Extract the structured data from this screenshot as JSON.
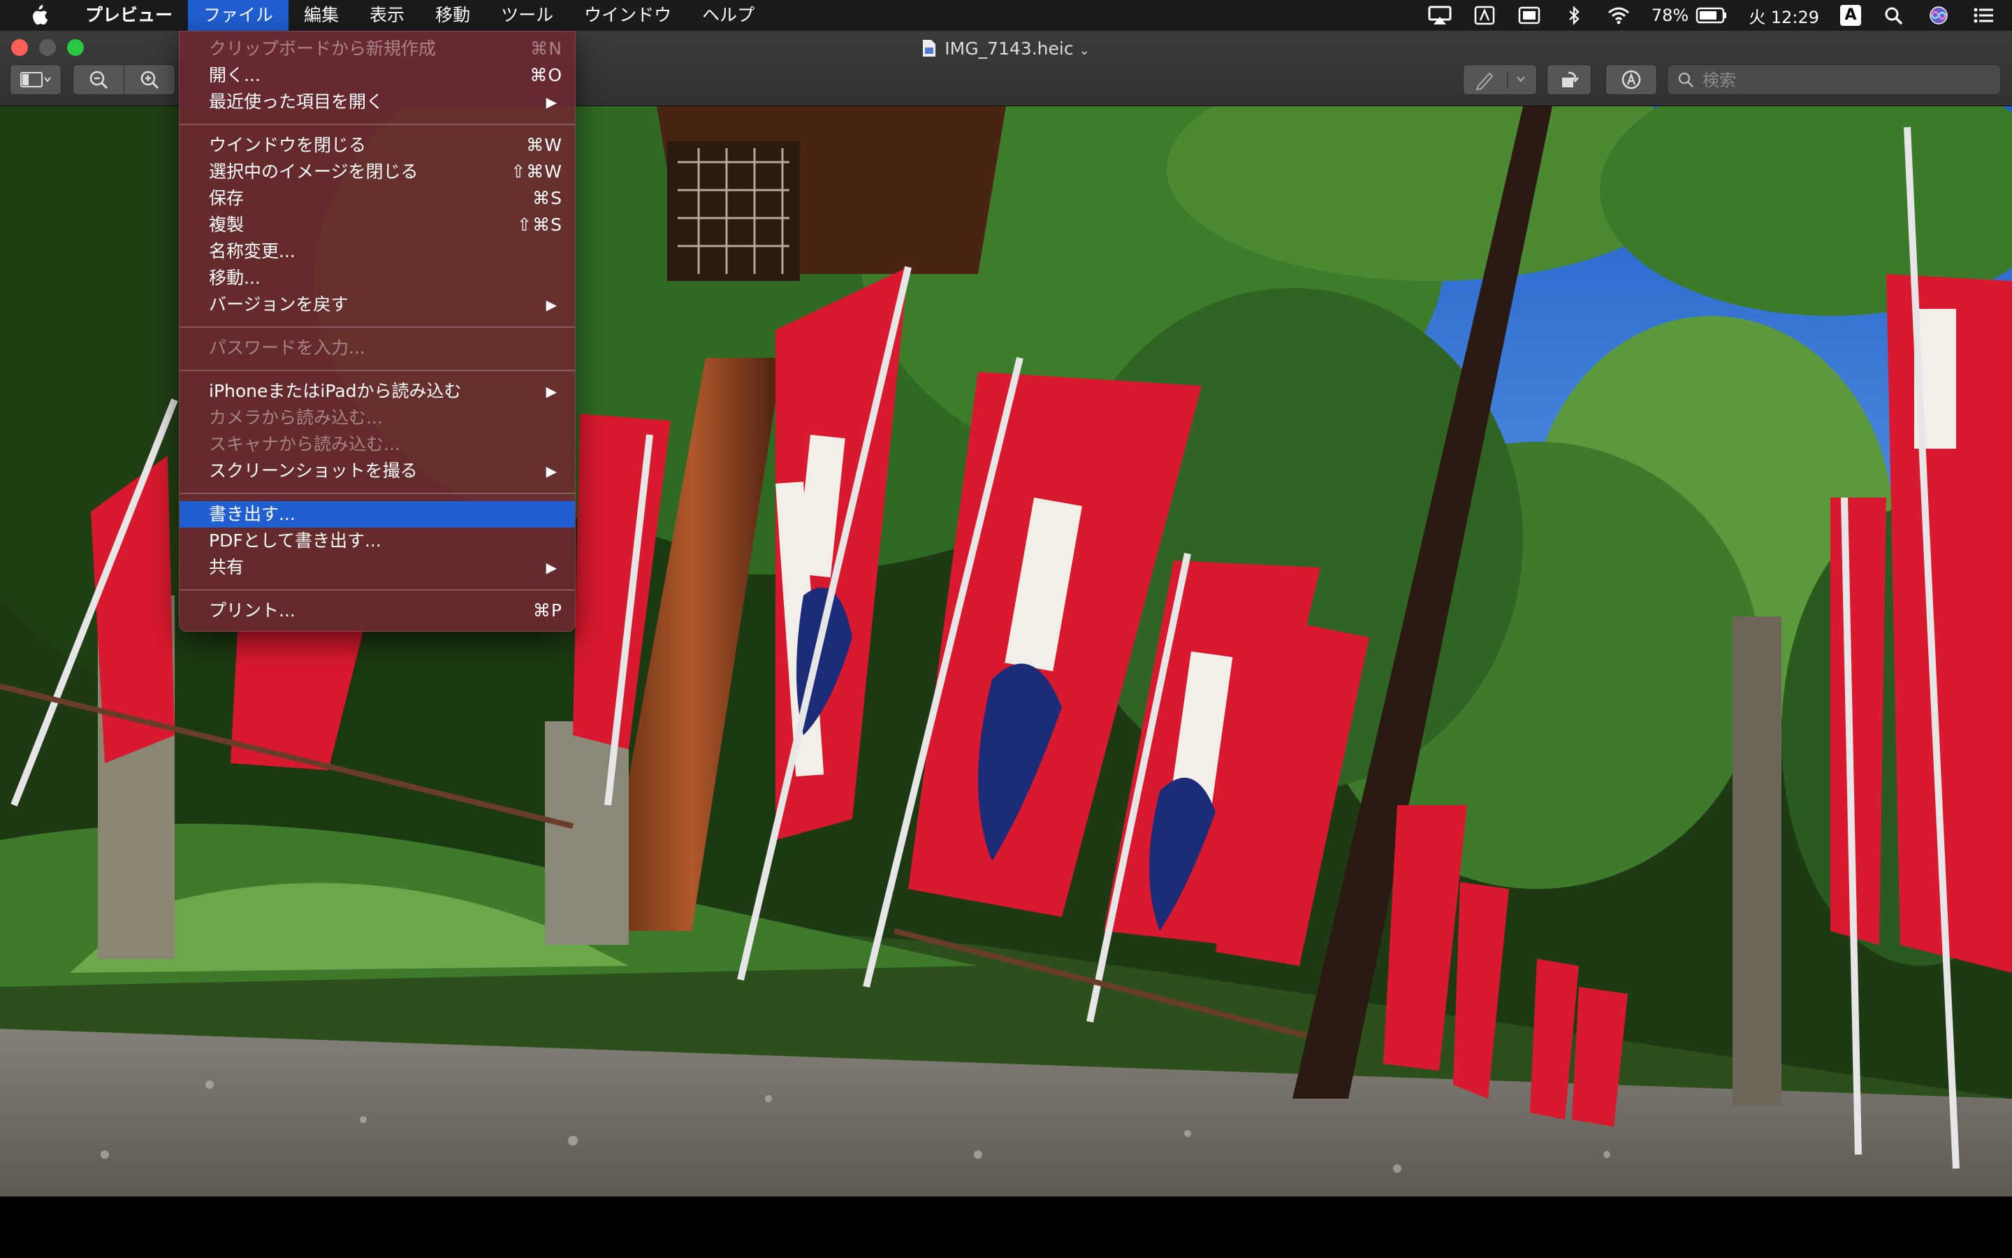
{
  "menubar": {
    "app_name": "プレビュー",
    "menus": [
      "ファイル",
      "編集",
      "表示",
      "移動",
      "ツール",
      "ウインドウ",
      "ヘルプ"
    ],
    "active_menu": "ファイル",
    "battery_percent": "78%",
    "clock": "火 12:29",
    "input_source": "A",
    "icons": [
      "apple-icon",
      "airplay-icon",
      "text-input-icon",
      "display-icon",
      "bluetooth-icon",
      "wifi-icon",
      "battery-icon",
      "spotlight-icon",
      "siri-icon",
      "notification-center-icon"
    ]
  },
  "window": {
    "title": "IMG_7143.heic",
    "search_placeholder": "検索"
  },
  "file_menu": {
    "items": [
      {
        "label": "クリップボードから新規作成",
        "shortcut": "⌘N",
        "disabled": true
      },
      {
        "label": "開く...",
        "shortcut": "⌘O",
        "disabled": false
      },
      {
        "label": "最近使った項目を開く",
        "shortcut": "▶",
        "disabled": false,
        "submenu": true
      },
      {
        "label": "ウインドウを閉じる",
        "shortcut": "⌘W",
        "disabled": false
      },
      {
        "label": "選択中のイメージを閉じる",
        "shortcut": "⇧⌘W",
        "disabled": false
      },
      {
        "label": "保存",
        "shortcut": "⌘S",
        "disabled": false
      },
      {
        "label": "複製",
        "shortcut": "⇧⌘S",
        "disabled": false
      },
      {
        "label": "名称変更...",
        "shortcut": "",
        "disabled": false
      },
      {
        "label": "移動...",
        "shortcut": "",
        "disabled": false
      },
      {
        "label": "バージョンを戻す",
        "shortcut": "▶",
        "disabled": false,
        "submenu": true
      },
      {
        "label": "パスワードを入力...",
        "shortcut": "",
        "disabled": true
      },
      {
        "label": "iPhoneまたはiPadから読み込む",
        "shortcut": "▶",
        "disabled": false,
        "submenu": true
      },
      {
        "label": "カメラから読み込む...",
        "shortcut": "",
        "disabled": true
      },
      {
        "label": "スキャナから読み込む...",
        "shortcut": "",
        "disabled": true
      },
      {
        "label": "スクリーンショットを撮る",
        "shortcut": "▶",
        "disabled": false,
        "submenu": true
      },
      {
        "label": "書き出す...",
        "shortcut": "",
        "disabled": false,
        "highlighted": true
      },
      {
        "label": "PDFとして書き出す...",
        "shortcut": "",
        "disabled": false
      },
      {
        "label": "共有",
        "shortcut": "▶",
        "disabled": false,
        "submenu": true
      },
      {
        "label": "プリント...",
        "shortcut": "⌘P",
        "disabled": false
      }
    ]
  },
  "colors": {
    "menu_highlight": "#1f5fd1",
    "banner_red": "#d8192e",
    "sky": "#3b78d8",
    "foliage": "#2f6a22"
  }
}
